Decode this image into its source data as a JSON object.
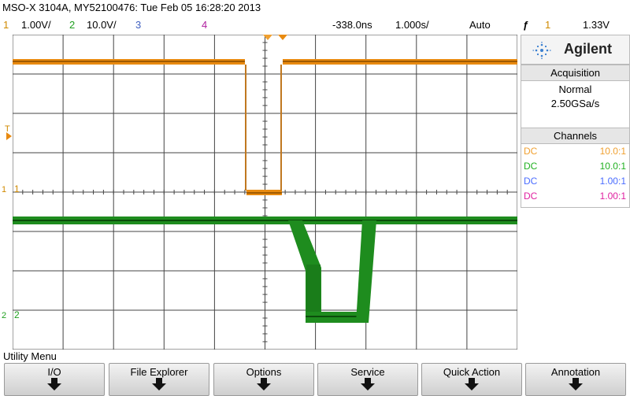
{
  "header": {
    "title": "MSO-X 3104A, MY52100476: Tue Feb 05 16:28:20 2013"
  },
  "channel_row": {
    "ch1_num": "1",
    "ch1_scale": "1.00V/",
    "ch2_num": "2",
    "ch2_scale": "10.0V/",
    "ch3_num": "3",
    "ch4_num": "4",
    "time_delay": "-338.0ns",
    "time_scale": "1.000s/",
    "trigger_mode": "Auto",
    "trigger_slope": "ƒ",
    "trigger_source": "1",
    "trigger_level": "1.33V"
  },
  "markers": {
    "trigger_level_marker": "T",
    "ch1_ground": "1",
    "ch1_label": "1",
    "ch2_ground": "2",
    "ch2_label": "2"
  },
  "brand": {
    "name": "Agilent"
  },
  "acquisition": {
    "header": "Acquisition",
    "mode": "Normal",
    "rate": "2.50GSa/s"
  },
  "channels": {
    "header": "Channels",
    "items": [
      {
        "coupling": "DC",
        "probe": "10.0:1",
        "color": "#f0a030"
      },
      {
        "coupling": "DC",
        "probe": "10.0:1",
        "color": "#20b020"
      },
      {
        "coupling": "DC",
        "probe": "1.00:1",
        "color": "#4a6cff"
      },
      {
        "coupling": "DC",
        "probe": "1.00:1",
        "color": "#e020a0"
      }
    ]
  },
  "menu": {
    "title": "Utility Menu",
    "buttons": [
      "I/O",
      "File Explorer",
      "Options",
      "Service",
      "Quick Action",
      "Annotation"
    ]
  },
  "colors": {
    "ch1": "#e88a10",
    "ch1_dark": "#b06a00",
    "ch2": "#1e8c1e",
    "ch3": "#5570c8",
    "ch4": "#b020a0",
    "grid": "#444444"
  },
  "icons": {
    "brand": "agilent-spark-icon",
    "button_arrow": "down-arrow-icon"
  }
}
